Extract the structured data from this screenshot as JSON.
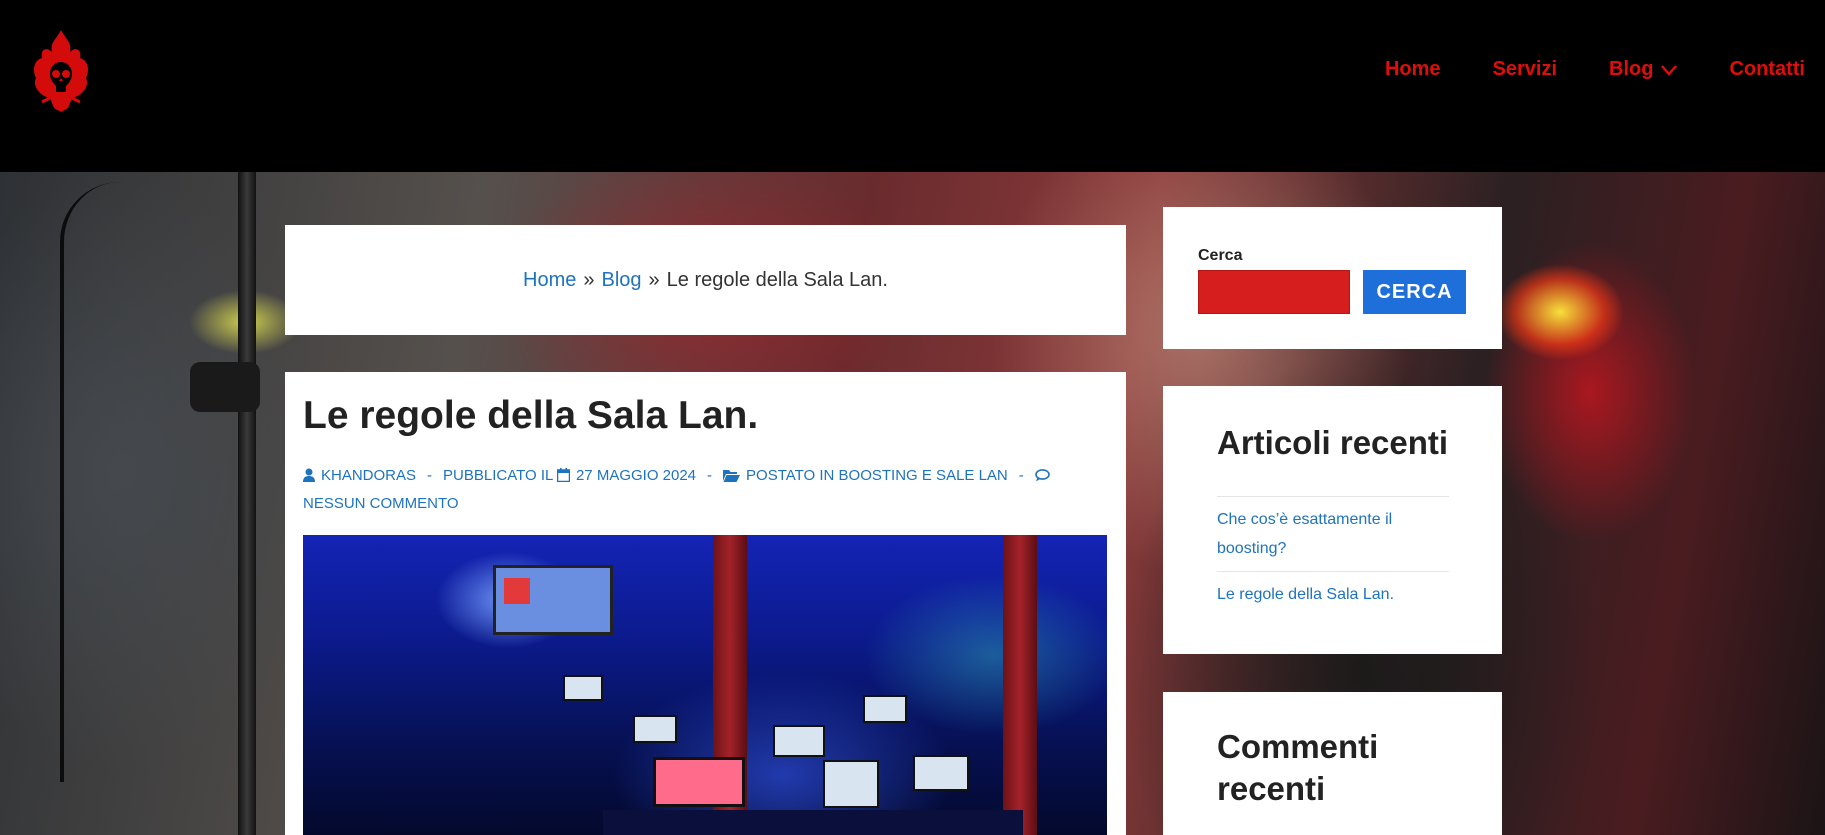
{
  "header": {
    "nav": [
      {
        "label": "Home"
      },
      {
        "label": "Servizi"
      },
      {
        "label": "Blog",
        "has_dropdown": true
      },
      {
        "label": "Contatti"
      }
    ],
    "accent_color": "#e00d0d"
  },
  "breadcrumb": {
    "home": "Home",
    "separator": "»",
    "blog": "Blog",
    "current": "Le regole della Sala Lan."
  },
  "article": {
    "title": "Le regole della Sala Lan.",
    "meta": {
      "author": "KHANDORAS",
      "dash": "-",
      "published_prefix": "PUBBLICATO IL",
      "date": "27 MAGGIO 2024",
      "posted_in": "POSTATO IN BOOSTING E SALE LAN",
      "comments": "NESSUN COMMENTO"
    }
  },
  "sidebar": {
    "search": {
      "label": "Cerca",
      "button_label": "CERCA",
      "input_value": ""
    },
    "recent_posts": {
      "title": "Articoli recenti",
      "items": [
        "Che cos’è esattamente il boosting?",
        "Le regole della Sala Lan."
      ]
    },
    "recent_comments": {
      "title": "Commenti recenti"
    }
  },
  "icons": {
    "logo": "flame-skull-logo",
    "author": "user-icon",
    "date": "calendar-icon",
    "category": "folder-open-icon",
    "comments": "comment-icon",
    "dropdown": "chevron-down-icon"
  }
}
